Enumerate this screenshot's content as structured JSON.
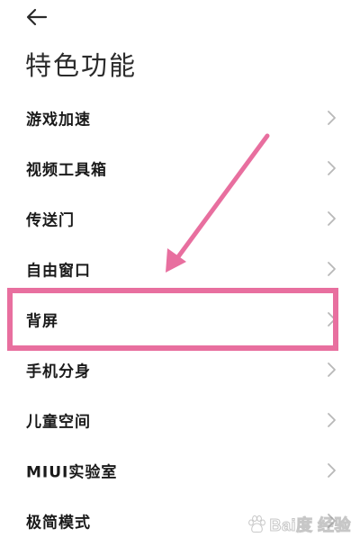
{
  "header": {
    "back_icon": "arrow-left-icon",
    "title": "特色功能"
  },
  "menu": {
    "items": [
      {
        "label": "游戏加速"
      },
      {
        "label": "视频工具箱"
      },
      {
        "label": "传送门"
      },
      {
        "label": "自由窗口"
      },
      {
        "label": "背屏"
      },
      {
        "label": "手机分身"
      },
      {
        "label": "儿童空间"
      },
      {
        "label": "MIUI实验室"
      },
      {
        "label": "极简模式"
      }
    ],
    "chevron_icon": "chevron-right-icon"
  },
  "annotation": {
    "highlighted_item": "背屏",
    "color": "#e86f9f"
  },
  "watermark": {
    "text": "Bai度 经验",
    "logo": "baidu-paw-logo"
  },
  "colors": {
    "background": "#ffffff",
    "text": "#1a1a1a",
    "chevron": "#b8b8b8",
    "annotation_pink": "#e86f9f"
  }
}
